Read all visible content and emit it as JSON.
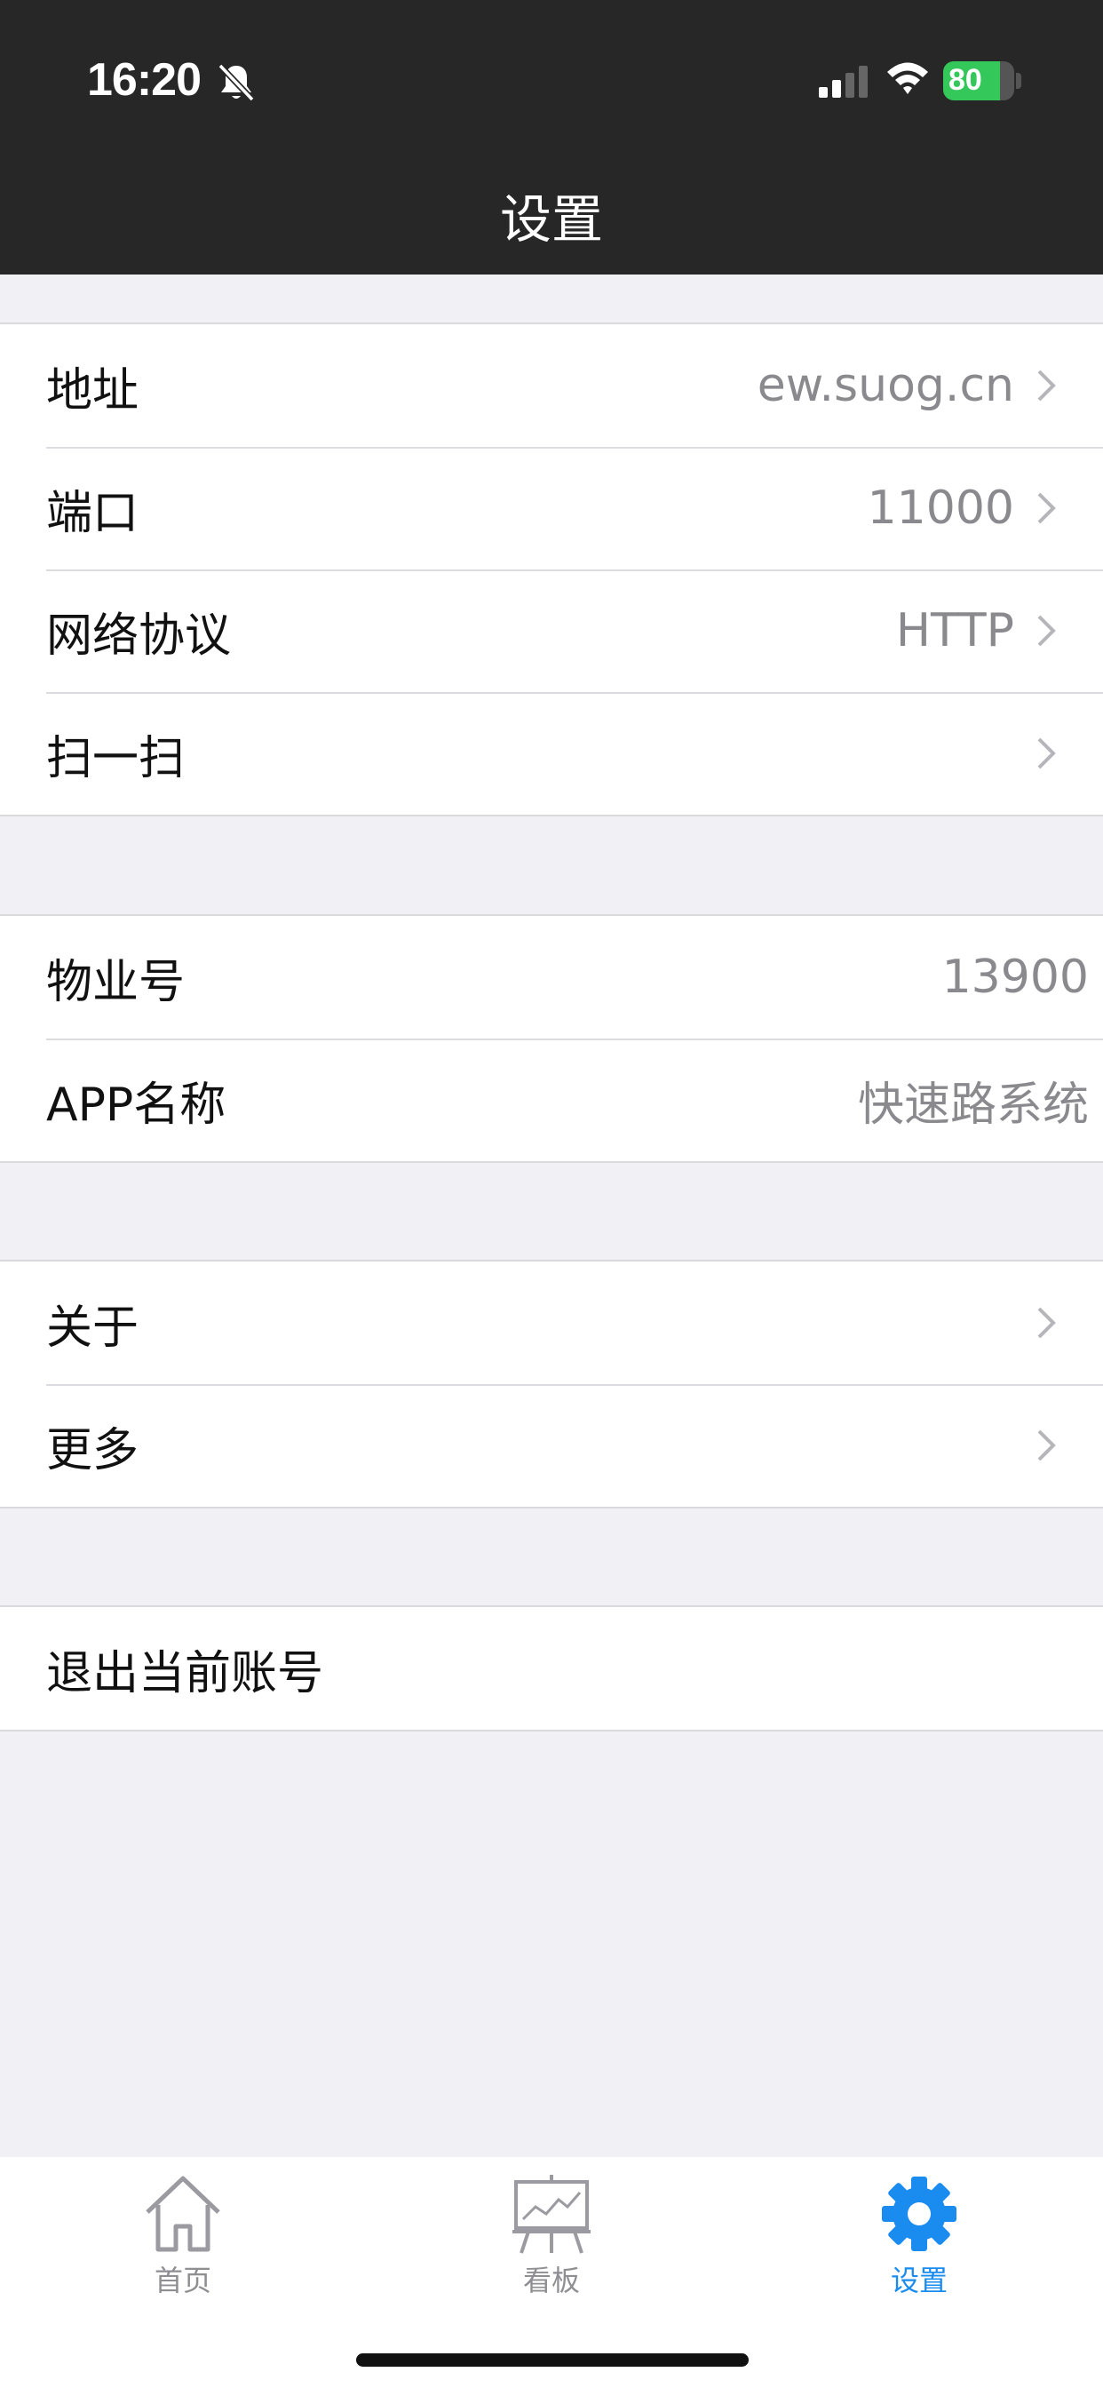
{
  "status_bar": {
    "time": "16:20",
    "battery": "80",
    "battery_level": 0.8
  },
  "nav": {
    "title": "设置"
  },
  "groups": {
    "connection": [
      {
        "label": "地址",
        "value": "ew.suog.cn"
      },
      {
        "label": "端口",
        "value": "11000"
      },
      {
        "label": "网络协议",
        "value": "HTTP"
      },
      {
        "label": "扫一扫",
        "value": ""
      }
    ],
    "info": [
      {
        "label": "物业号",
        "value": "13900"
      },
      {
        "label": "APP名称",
        "value": "快速路系统"
      }
    ],
    "misc": [
      {
        "label": "关于"
      },
      {
        "label": "更多"
      }
    ],
    "account": [
      {
        "label": "退出当前账号"
      }
    ]
  },
  "tabbar": {
    "items": [
      {
        "label": "首页",
        "icon": "home-icon",
        "active": false
      },
      {
        "label": "看板",
        "icon": "board-icon",
        "active": false
      },
      {
        "label": "设置",
        "icon": "gear-icon",
        "active": true
      }
    ],
    "active_color": "#1a8cf0",
    "inactive_color": "#8e8e93"
  }
}
